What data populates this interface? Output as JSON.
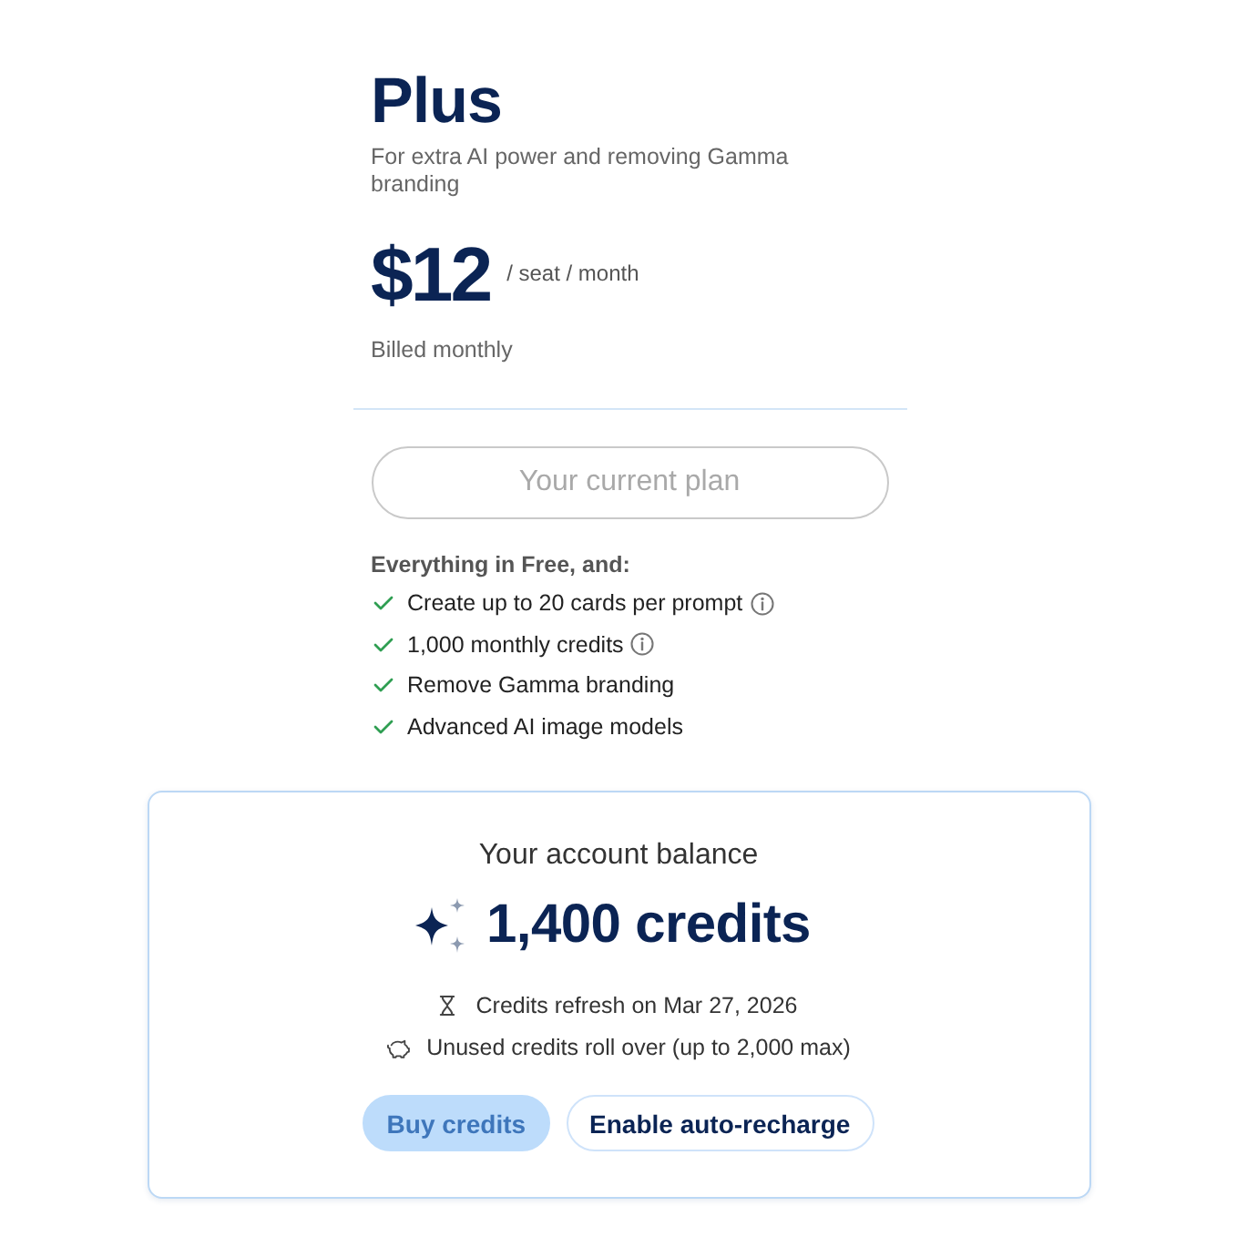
{
  "plan": {
    "name": "Plus",
    "description": "For extra AI power and removing Gamma branding",
    "price": "$12",
    "price_unit": "/ seat / month",
    "billing": "Billed monthly",
    "button": {
      "label": "Your current plan",
      "disabled": true
    },
    "features_heading": "Everything in Free, and:",
    "features": [
      {
        "label": "Create up to 20 cards per prompt",
        "info": true
      },
      {
        "label": "1,000 monthly credits",
        "info": true
      },
      {
        "label": "Remove Gamma branding",
        "info": false
      },
      {
        "label": "Advanced AI image models",
        "info": false
      }
    ]
  },
  "balance": {
    "title": "Your account balance",
    "amount": "1,400 credits",
    "notes": [
      {
        "kind": "refresh",
        "text": "Credits refresh on Mar 27, 2026"
      },
      {
        "kind": "rollover",
        "text": "Unused credits roll over (up to 2,000 max)"
      }
    ],
    "buttons": [
      {
        "kind": "primary",
        "label": "Buy credits",
        "disabled": true
      },
      {
        "kind": "secondary",
        "label": "Enable auto-recharge",
        "disabled": false
      }
    ]
  }
}
